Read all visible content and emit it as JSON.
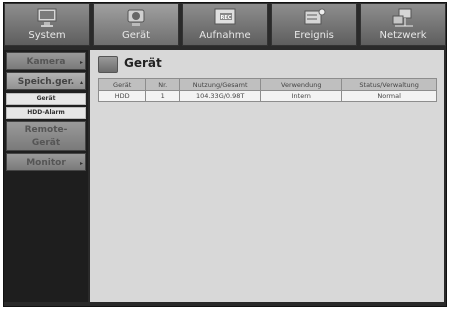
{
  "tabs": [
    {
      "label": "System",
      "icon": "monitor-icon"
    },
    {
      "label": "Gerät",
      "icon": "camera-icon"
    },
    {
      "label": "Aufnahme",
      "icon": "rec-icon"
    },
    {
      "label": "Ereignis",
      "icon": "alarm-icon"
    },
    {
      "label": "Netzwerk",
      "icon": "network-icon"
    }
  ],
  "sidebar": {
    "items": [
      {
        "label": "Kamera",
        "mark": "▸"
      },
      {
        "label": "Speich.ger.",
        "mark": "▴"
      },
      {
        "label": "Gerät"
      },
      {
        "label": "HDD-Alarm"
      },
      {
        "label": "Remote-Gerät"
      },
      {
        "label": "Monitor",
        "mark": "▸"
      }
    ]
  },
  "main": {
    "title": "Gerät",
    "columns": [
      "Gerät",
      "Nr.",
      "Nutzung/Gesamt",
      "Verwendung",
      "Status/Verwaltung"
    ],
    "rows": [
      [
        "HDD",
        "1",
        "104.33G/0.98T",
        "Intern",
        "Normal"
      ]
    ]
  },
  "colors": {
    "frame": "#2a2a2a",
    "tab": "#7a7a7a",
    "content_bg": "#d8d8d8"
  }
}
